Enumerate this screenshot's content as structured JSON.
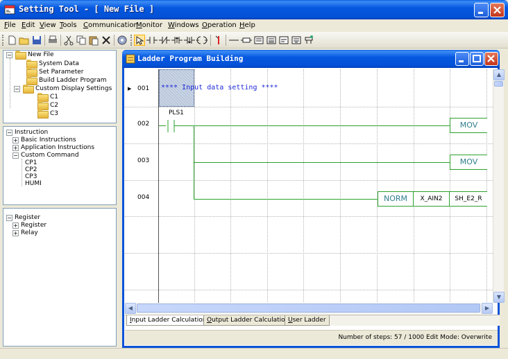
{
  "app": {
    "title": "Setting Tool - [ New File ]"
  },
  "menu": [
    "File",
    "Edit",
    "View",
    "Tools",
    "Communication",
    "Monitor",
    "Windows",
    "Operation",
    "Help"
  ],
  "project_tree": {
    "root": "New File",
    "items": [
      "System Data",
      "Set Parameter",
      "Build Ladder Program",
      "Custom Display Settings"
    ],
    "custom_display": [
      "C1",
      "C2",
      "C3"
    ]
  },
  "instruction_tree": {
    "root": "Instruction",
    "items": [
      "Basic Instructions",
      "Application Instructions",
      "Custom Command"
    ],
    "custom_commands": [
      "CP1",
      "CP2",
      "CP3",
      "HUMI"
    ]
  },
  "register_tree": {
    "root": "Register",
    "items": [
      "Register",
      "Relay"
    ]
  },
  "ladder_window": {
    "title": "Ladder Program Building",
    "rows": [
      "001",
      "002",
      "003",
      "004"
    ],
    "comment": "**** Input data setting ****",
    "contact_label": "PLS1",
    "boxes": {
      "mov1": "MOV",
      "mov2": "MOV",
      "norm": "NORM",
      "xain2": "X_AIN2",
      "she2r": "SH_E2_R"
    },
    "tabs": [
      "Input Ladder Calculation",
      "Output Ladder Calculation",
      "User Ladder"
    ],
    "status": "Number of steps: 57 / 1000 Edit Mode: Overwrite"
  },
  "colors": {
    "title_blue": "#0658e0",
    "wire_green": "#2ca02c",
    "comment_blue": "#1d28d6"
  }
}
